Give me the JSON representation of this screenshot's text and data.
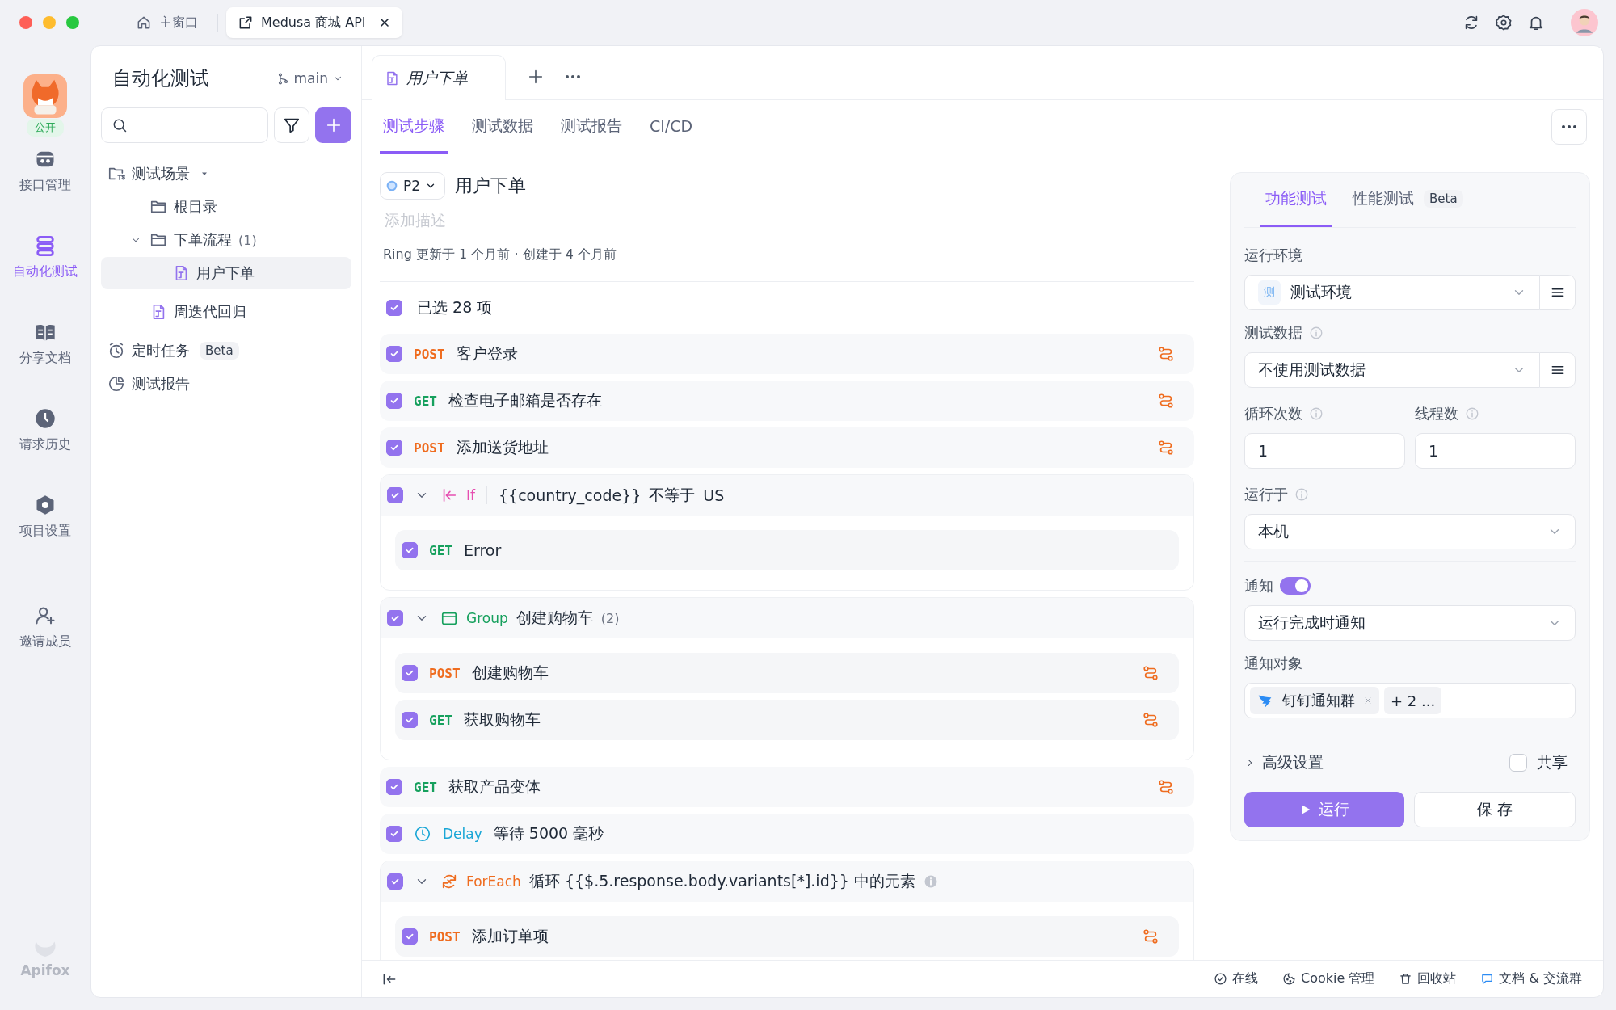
{
  "title_bar": {
    "tabs": [
      {
        "label": "主窗口",
        "selected": false,
        "closable": false
      },
      {
        "label": "Medusa 商城 API",
        "selected": true,
        "closable": true
      }
    ]
  },
  "nav": {
    "project_badge": "公开",
    "brand": "Apifox",
    "items": [
      {
        "label": "接口管理",
        "selected": false
      },
      {
        "label": "自动化测试",
        "selected": true
      },
      {
        "label": "分享文档",
        "selected": false
      },
      {
        "label": "请求历史",
        "selected": false
      },
      {
        "label": "项目设置",
        "selected": false
      },
      {
        "label": "邀请成员",
        "selected": false
      }
    ]
  },
  "tree_panel": {
    "title": "自动化测试",
    "branch": "main",
    "items": [
      {
        "label": "测试场景",
        "kind": "scenarios",
        "expanded": true,
        "selected": false,
        "children": [
          {
            "label": "根目录",
            "kind": "folder",
            "selected": false
          },
          {
            "label": "下单流程",
            "count": "(1)",
            "kind": "folder",
            "expanded": true,
            "selected": false,
            "children": [
              {
                "label": "用户下单",
                "kind": "script",
                "selected": true
              }
            ]
          },
          {
            "label": "周迭代回归",
            "kind": "script",
            "selected": false
          }
        ]
      },
      {
        "label": "定时任务",
        "badge": "Beta",
        "kind": "schedule",
        "selected": false
      },
      {
        "label": "测试报告",
        "kind": "report",
        "selected": false
      }
    ]
  },
  "open_tabs": [
    {
      "label": "用户下单",
      "selected": true
    }
  ],
  "sub_tabs": [
    {
      "label": "测试步骤",
      "selected": true
    },
    {
      "label": "测试数据",
      "selected": false
    },
    {
      "label": "测试报告",
      "selected": false
    },
    {
      "label": "CI/CD",
      "selected": false
    }
  ],
  "scenario": {
    "priority": "P2",
    "title": "用户下单",
    "description_placeholder": "添加描述",
    "meta": "Ring 更新于 1 个月前 · 创建于 4 个月前"
  },
  "selection": {
    "checked": true,
    "label": "已选 28 项"
  },
  "steps": [
    {
      "kind": "request",
      "method": "POST",
      "name": "客户登录",
      "checked": true,
      "linked": true
    },
    {
      "kind": "request",
      "method": "GET",
      "name": "检查电子邮箱是否存在",
      "checked": true,
      "linked": true
    },
    {
      "kind": "request",
      "method": "POST",
      "name": "添加送货地址",
      "checked": true,
      "linked": true
    },
    {
      "kind": "if",
      "label": "If",
      "condition": "{{country_code}}",
      "operator": "不等于",
      "value": "US",
      "checked": true,
      "expanded": true,
      "children": [
        {
          "kind": "request",
          "method": "GET",
          "name": "Error",
          "checked": true,
          "linked": false
        }
      ]
    },
    {
      "kind": "group",
      "label": "Group",
      "name": "创建购物车",
      "count": "(2)",
      "checked": true,
      "expanded": true,
      "children": [
        {
          "kind": "request",
          "method": "POST",
          "name": "创建购物车",
          "checked": true,
          "linked": true
        },
        {
          "kind": "request",
          "method": "GET",
          "name": "获取购物车",
          "checked": true,
          "linked": true
        }
      ]
    },
    {
      "kind": "request",
      "method": "GET",
      "name": "获取产品变体",
      "checked": true,
      "linked": true
    },
    {
      "kind": "delay",
      "label": "Delay",
      "text": "等待 5000 毫秒",
      "checked": true
    },
    {
      "kind": "foreach",
      "label": "ForEach",
      "text": "循环 {{$.5.response.body.variants[*].id}} 中的元素",
      "info": true,
      "checked": true,
      "expanded": true,
      "children": [
        {
          "kind": "request",
          "method": "POST",
          "name": "添加订单项",
          "checked": true,
          "linked": true
        }
      ]
    }
  ],
  "run_panel": {
    "tabs": [
      {
        "label": "功能测试",
        "selected": true
      },
      {
        "label": "性能测试",
        "badge": "Beta",
        "selected": false
      }
    ],
    "environment": {
      "label": "运行环境",
      "badge": "测",
      "value": "测试环境"
    },
    "test_data": {
      "label": "测试数据",
      "info": true,
      "value": "不使用测试数据"
    },
    "loops": {
      "label": "循环次数",
      "info": true,
      "value": "1"
    },
    "threads": {
      "label": "线程数",
      "info": true,
      "value": "1"
    },
    "run_on": {
      "label": "运行于",
      "info": true,
      "value": "本机"
    },
    "notify": {
      "label": "通知",
      "on": true,
      "mode": "运行完成时通知"
    },
    "notify_targets": {
      "label": "通知对象",
      "tags": [
        "钉钉通知群"
      ],
      "more": "+ 2 ..."
    },
    "advanced": {
      "label": "高级设置",
      "expanded": false
    },
    "share": {
      "label": "共享",
      "checked": false
    },
    "run_button": "运行",
    "save_button": "保 存"
  },
  "status_bar": {
    "items": [
      {
        "label": "在线"
      },
      {
        "label": "Cookie 管理"
      },
      {
        "label": "回收站"
      },
      {
        "label": "文档 & 交流群"
      }
    ]
  }
}
